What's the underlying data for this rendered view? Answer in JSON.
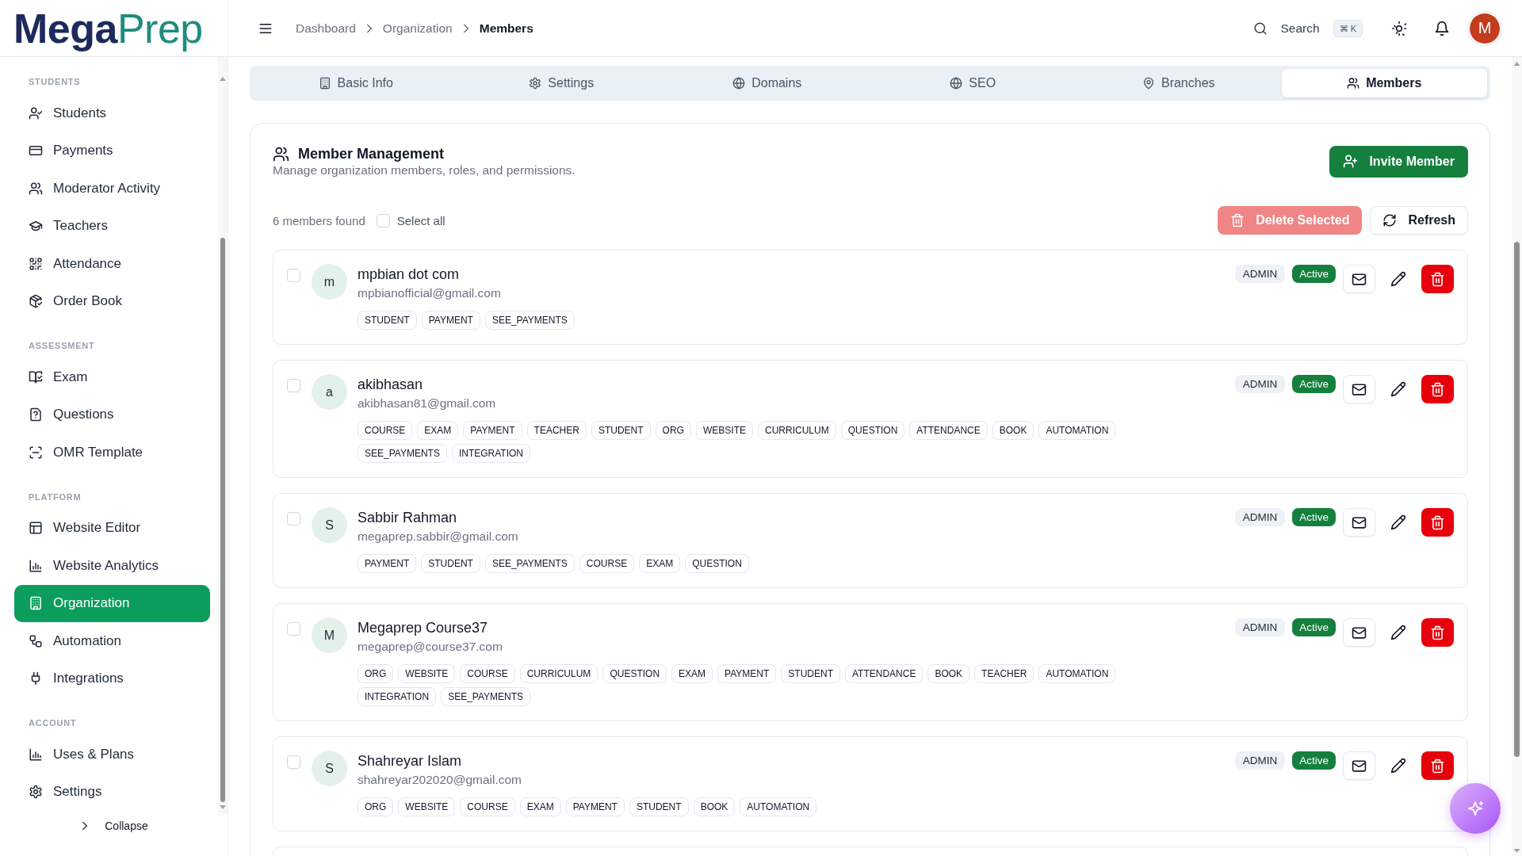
{
  "logo": [
    "Mega",
    "Prep"
  ],
  "sidebar": {
    "sections": [
      {
        "label": "STUDENTS",
        "items": [
          {
            "label": "Students",
            "selected": false
          },
          {
            "label": "Payments",
            "selected": false
          },
          {
            "label": "Moderator Activity",
            "selected": false
          },
          {
            "label": "Teachers",
            "selected": false
          },
          {
            "label": "Attendance",
            "selected": false
          },
          {
            "label": "Order Book",
            "selected": false
          }
        ]
      },
      {
        "label": "ASSESSMENT",
        "items": [
          {
            "label": "Exam",
            "selected": false
          },
          {
            "label": "Questions",
            "selected": false
          },
          {
            "label": "OMR Template",
            "selected": false
          }
        ]
      },
      {
        "label": "PLATFORM",
        "items": [
          {
            "label": "Website Editor",
            "selected": false
          },
          {
            "label": "Website Analytics",
            "selected": false
          },
          {
            "label": "Organization",
            "selected": true
          },
          {
            "label": "Automation",
            "selected": false
          },
          {
            "label": "Integrations",
            "selected": false
          }
        ]
      },
      {
        "label": "ACCOUNT",
        "items": [
          {
            "label": "Uses & Plans",
            "selected": false
          },
          {
            "label": "Settings",
            "selected": false
          }
        ]
      }
    ],
    "collapse": "Collapse"
  },
  "header": {
    "breadcrumbs": [
      "Dashboard",
      "Organization",
      "Members"
    ],
    "search": {
      "label": "Search",
      "shortcut": "⌘ K"
    },
    "avatar": "M"
  },
  "tabs": [
    {
      "label": "Basic Info",
      "selected": false
    },
    {
      "label": "Settings",
      "selected": false
    },
    {
      "label": "Domains",
      "selected": false
    },
    {
      "label": "SEO",
      "selected": false
    },
    {
      "label": "Branches",
      "selected": false
    },
    {
      "label": "Members",
      "selected": true
    }
  ],
  "panel": {
    "title": "Member Management",
    "subtitle": "Manage organization members, roles, and permissions.",
    "invite_button": "Invite Member",
    "count": "6 members found",
    "select_all": {
      "label": "Select all",
      "checked": false
    },
    "delete_button": {
      "label": "Delete Selected",
      "disabled": true
    },
    "refresh_button": "Refresh"
  },
  "members": [
    {
      "initial": "m",
      "name": "mpbian dot com",
      "email": "mpbianofficial@gmail.com",
      "permissions": [
        "STUDENT",
        "PAYMENT",
        "SEE_PAYMENTS"
      ],
      "role": "ADMIN",
      "status": "Active",
      "selected": false
    },
    {
      "initial": "a",
      "name": "akibhasan",
      "email": "akibhasan81@gmail.com",
      "permissions": [
        "COURSE",
        "EXAM",
        "PAYMENT",
        "TEACHER",
        "STUDENT",
        "ORG",
        "WEBSITE",
        "CURRICULUM",
        "QUESTION",
        "ATTENDANCE",
        "BOOK",
        "AUTOMATION",
        "SEE_PAYMENTS",
        "INTEGRATION"
      ],
      "role": "ADMIN",
      "status": "Active",
      "selected": false
    },
    {
      "initial": "S",
      "name": "Sabbir Rahman",
      "email": "megaprep.sabbir@gmail.com",
      "permissions": [
        "PAYMENT",
        "STUDENT",
        "SEE_PAYMENTS",
        "COURSE",
        "EXAM",
        "QUESTION"
      ],
      "role": "ADMIN",
      "status": "Active",
      "selected": false
    },
    {
      "initial": "M",
      "name": "Megaprep Course37",
      "email": "megaprep@course37.com",
      "permissions": [
        "ORG",
        "WEBSITE",
        "COURSE",
        "CURRICULUM",
        "QUESTION",
        "EXAM",
        "PAYMENT",
        "STUDENT",
        "ATTENDANCE",
        "BOOK",
        "TEACHER",
        "AUTOMATION",
        "INTEGRATION",
        "SEE_PAYMENTS"
      ],
      "role": "ADMIN",
      "status": "Active",
      "selected": false
    },
    {
      "initial": "S",
      "name": "Shahreyar Islam",
      "email": "shahreyar202020@gmail.com",
      "permissions": [
        "ORG",
        "WEBSITE",
        "COURSE",
        "EXAM",
        "PAYMENT",
        "STUDENT",
        "BOOK",
        "AUTOMATION"
      ],
      "role": "ADMIN",
      "status": "Active",
      "selected": false
    }
  ]
}
